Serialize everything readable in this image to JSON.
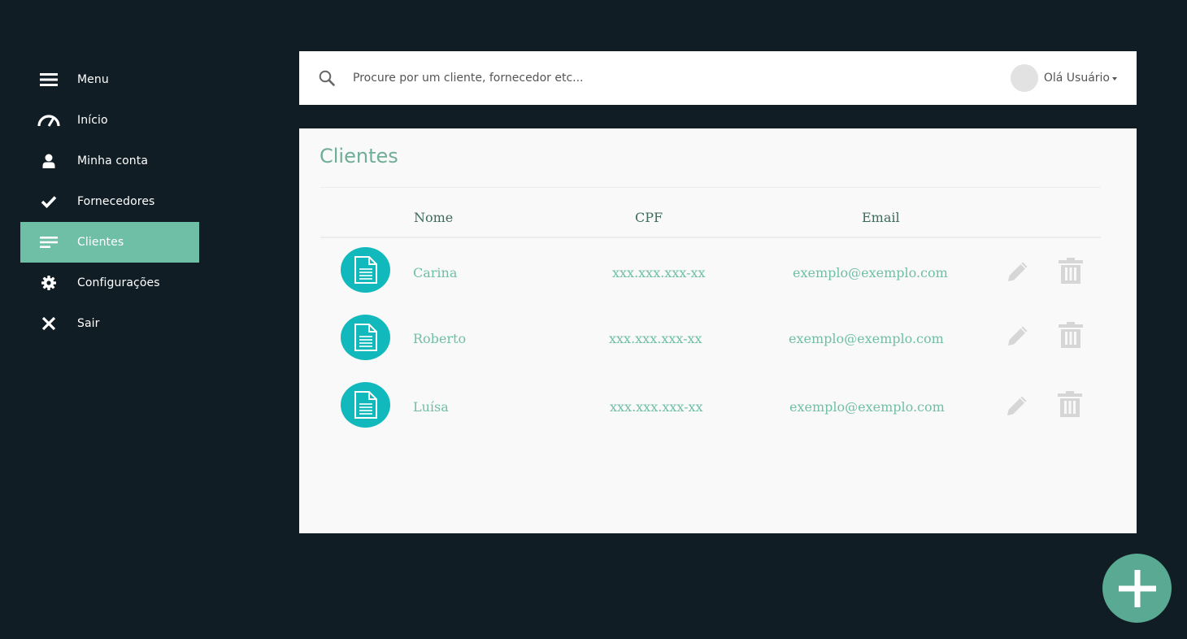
{
  "sidebar": {
    "items": [
      {
        "label": "Menu",
        "icon": "hamburger-icon"
      },
      {
        "label": "Início",
        "icon": "speedometer-icon"
      },
      {
        "label": "Minha conta",
        "icon": "user-icon"
      },
      {
        "label": "Fornecedores",
        "icon": "check-icon"
      },
      {
        "label": "Clientes",
        "icon": "list-icon",
        "active": true
      },
      {
        "label": "Configurações",
        "icon": "gear-icon"
      },
      {
        "label": "Sair",
        "icon": "close-icon"
      }
    ]
  },
  "topbar": {
    "search_placeholder": "Procure por um cliente, fornecedor etc...",
    "user_greeting": "Olá Usuário"
  },
  "main": {
    "title": "Clientes",
    "columns": [
      "Nome",
      "CPF",
      "Email"
    ],
    "rows": [
      {
        "name": "Carina",
        "cpf": "xxx.xxx.xxx-xx",
        "email": "exemplo@exemplo.com"
      },
      {
        "name": "Roberto",
        "cpf": "xxx.xxx.xxx-xx",
        "email": "exemplo@exemplo.com"
      },
      {
        "name": "Luísa",
        "cpf": "xxx.xxx.xxx-xx",
        "email": "exemplo@exemplo.com"
      }
    ]
  },
  "colors": {
    "background": "#111d25",
    "accent": "#6fbfa7",
    "doc_button": "#11b9bd",
    "fab": "#59a993",
    "action_icon": "#d6d6d6"
  },
  "fab": {
    "icon": "plus-icon"
  }
}
